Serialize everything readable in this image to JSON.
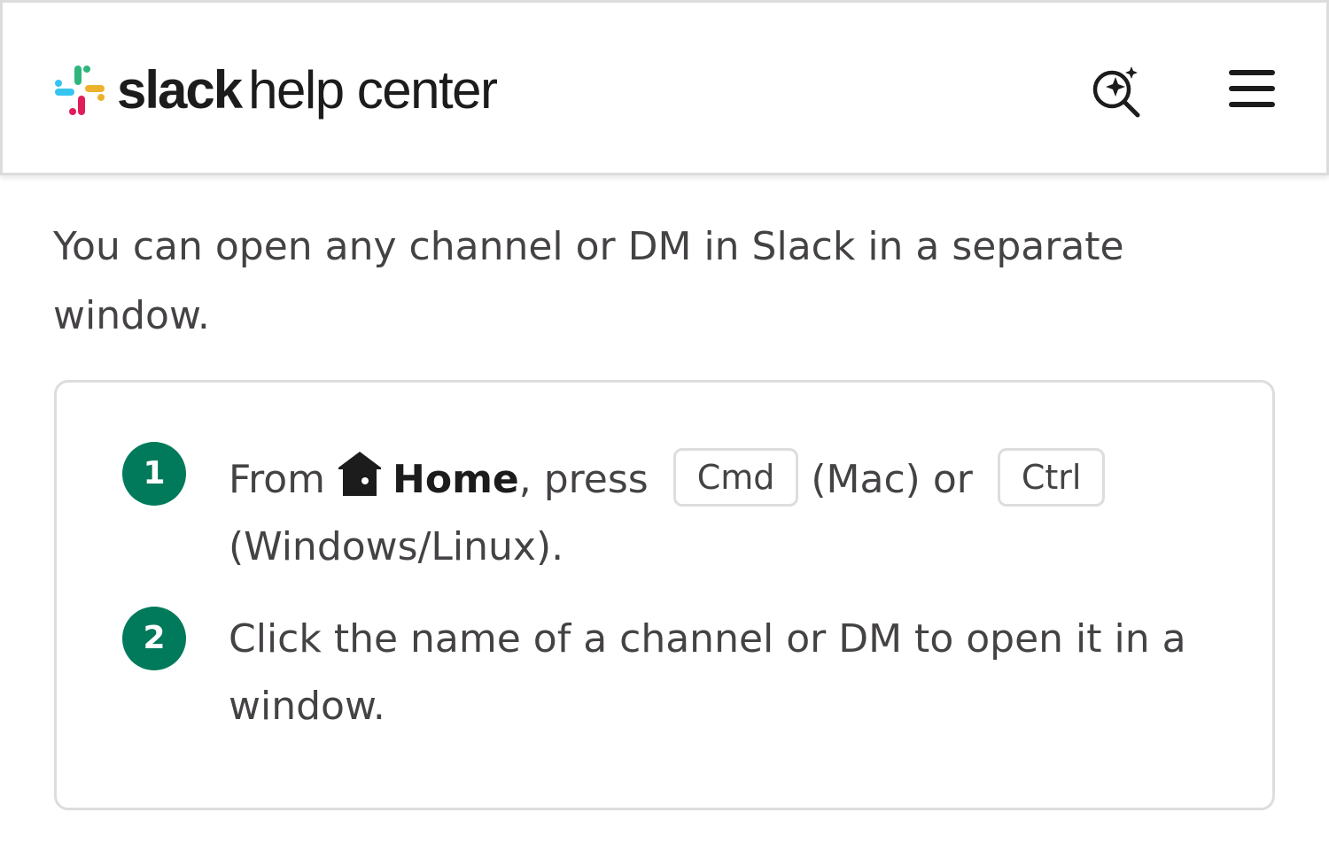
{
  "header": {
    "brand_bold": "slack",
    "brand_rest": "help center",
    "search_icon": "ai-search-sparkle-icon",
    "menu_icon": "hamburger-menu-icon"
  },
  "intro": "You can open any channel or DM in Slack in a separate window.",
  "steps": [
    {
      "number": "1",
      "from": "From",
      "icon": "home-icon",
      "bold": "Home",
      "press": ", press",
      "key1": "Cmd",
      "mac": "(Mac) or",
      "key2": "Ctrl",
      "windows": "(Windows/Linux)."
    },
    {
      "number": "2",
      "text": "Click the name of a channel or DM to open it in a window."
    }
  ],
  "colors": {
    "step_badge": "#007a5a",
    "text": "#454245",
    "logo_blue": "#36c5f0",
    "logo_green": "#2eb67d",
    "logo_yellow": "#ecb22e",
    "logo_red": "#e01e5a"
  }
}
